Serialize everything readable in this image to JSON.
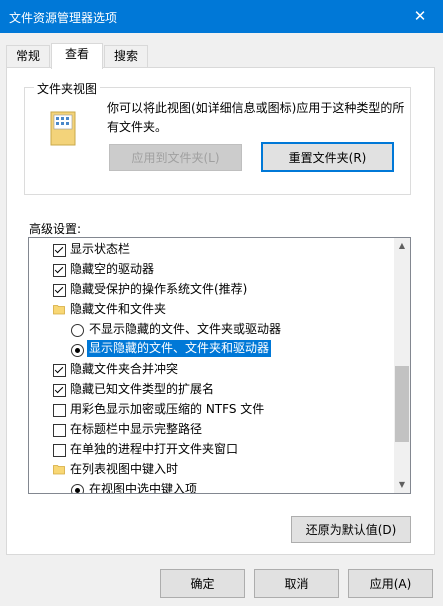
{
  "window": {
    "title": "文件资源管理器选项",
    "close_glyph": "✕"
  },
  "tabs": [
    {
      "label": "常规",
      "active": false
    },
    {
      "label": "查看",
      "active": true
    },
    {
      "label": "搜索",
      "active": false
    }
  ],
  "folder_view": {
    "title": "文件夹视图",
    "description": "你可以将此视图(如详细信息或图标)应用于这种类型的所有文件夹。",
    "apply_button": "应用到文件夹(L)",
    "reset_button": "重置文件夹(R)"
  },
  "advanced": {
    "label": "高级设置:",
    "items": [
      {
        "type": "checkbox",
        "checked": true,
        "indent": 0,
        "label": "显示状态栏"
      },
      {
        "type": "checkbox",
        "checked": true,
        "indent": 0,
        "label": "隐藏空的驱动器"
      },
      {
        "type": "checkbox",
        "checked": true,
        "indent": 0,
        "label": "隐藏受保护的操作系统文件(推荐)"
      },
      {
        "type": "folder",
        "checked": false,
        "indent": 0,
        "label": "隐藏文件和文件夹"
      },
      {
        "type": "radio",
        "checked": false,
        "indent": 1,
        "label": "不显示隐藏的文件、文件夹或驱动器"
      },
      {
        "type": "radio",
        "checked": true,
        "indent": 1,
        "label": "显示隐藏的文件、文件夹和驱动器",
        "selected": true
      },
      {
        "type": "checkbox",
        "checked": true,
        "indent": 0,
        "label": "隐藏文件夹合并冲突"
      },
      {
        "type": "checkbox",
        "checked": true,
        "indent": 0,
        "label": "隐藏已知文件类型的扩展名"
      },
      {
        "type": "checkbox",
        "checked": false,
        "indent": 0,
        "label": "用彩色显示加密或压缩的 NTFS 文件"
      },
      {
        "type": "checkbox",
        "checked": false,
        "indent": 0,
        "label": "在标题栏中显示完整路径"
      },
      {
        "type": "checkbox",
        "checked": false,
        "indent": 0,
        "label": "在单独的进程中打开文件夹窗口"
      },
      {
        "type": "folder",
        "checked": false,
        "indent": 0,
        "label": "在列表视图中键入时"
      },
      {
        "type": "radio",
        "checked": true,
        "indent": 1,
        "label": "在视图中选中键入项"
      }
    ]
  },
  "restore_button": "还原为默认值(D)",
  "footer": {
    "ok": "确定",
    "cancel": "取消",
    "apply": "应用(A)"
  },
  "colors": {
    "accent": "#0078d7",
    "selection": "#0078d7",
    "folder": "#f8d775"
  }
}
